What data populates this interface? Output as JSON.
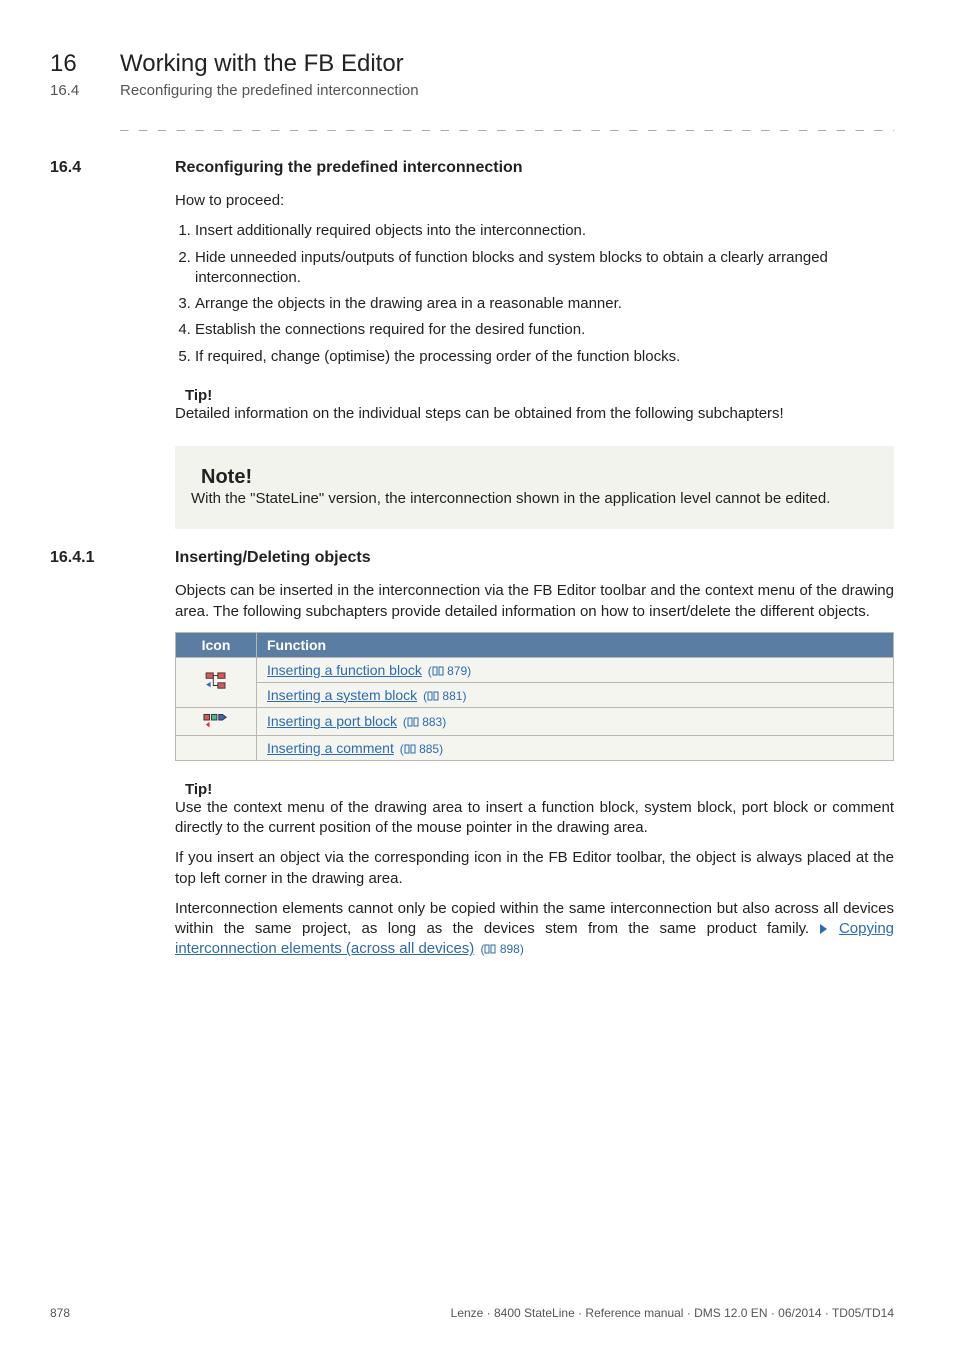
{
  "header": {
    "chapter_number": "16",
    "chapter_title": "Working with the FB Editor",
    "section_number": "16.4",
    "section_title": "Reconfiguring the predefined interconnection",
    "dashes": "_ _ _ _ _ _ _ _ _ _ _ _ _ _ _ _ _ _ _ _ _ _ _ _ _ _ _ _ _ _ _ _ _ _ _ _ _ _ _ _ _ _ _ _ _ _ _ _ _ _ _ _ _ _ _ _ _ _ _ _ _ _ _ _"
  },
  "s164": {
    "number": "16.4",
    "title": "Reconfiguring the predefined interconnection",
    "intro": "How to proceed:",
    "steps": [
      "Insert additionally required objects into the interconnection.",
      "Hide unneeded inputs/outputs of function blocks and system blocks to obtain a clearly arranged interconnection.",
      "Arrange the objects in the drawing area in a reasonable manner.",
      "Establish the connections required for the desired function.",
      "If required, change (optimise) the processing order of the function blocks."
    ],
    "tip": {
      "label": "Tip!",
      "text": "Detailed information on the individual steps can be obtained from the following subchapters!"
    },
    "note": {
      "label": "Note!",
      "text": "With the \"StateLine\" version, the interconnection shown in the application level cannot be edited."
    }
  },
  "s1641": {
    "number": "16.4.1",
    "title": "Inserting/Deleting objects",
    "intro": "Objects can be inserted in the interconnection via the FB Editor toolbar and the context menu of the drawing area. The following subchapters provide detailed information on how to insert/delete the different objects.",
    "table": {
      "head_icon": "Icon",
      "head_fn": "Function",
      "rows": [
        {
          "icon": "fb-block-icon",
          "link": "Inserting a function block",
          "page": "879"
        },
        {
          "icon": "",
          "link": "Inserting a system block",
          "page": "881"
        },
        {
          "icon": "port-block-icon",
          "link": "Inserting a port block",
          "page": "883"
        },
        {
          "icon": "",
          "link": "Inserting a comment",
          "page": "885"
        }
      ]
    },
    "tip": {
      "label": "Tip!",
      "p1": "Use the context menu of the drawing area to insert a function block, system block, port block or comment directly to the current position of the mouse pointer in the drawing area.",
      "p2": "If you insert an object via the corresponding icon in the FB Editor toolbar, the object is always placed at the top left corner in the drawing area.",
      "p3a": "Interconnection elements cannot only be copied within the same interconnection but also across all devices within the same project, as long as the devices stem from the same product family.",
      "p3_link": "Copying interconnection elements (across all devices)",
      "p3_page": "898"
    }
  },
  "footer": {
    "page": "878",
    "meta": "Lenze · 8400 StateLine · Reference manual · DMS 12.0 EN · 06/2014 · TD05/TD14"
  }
}
